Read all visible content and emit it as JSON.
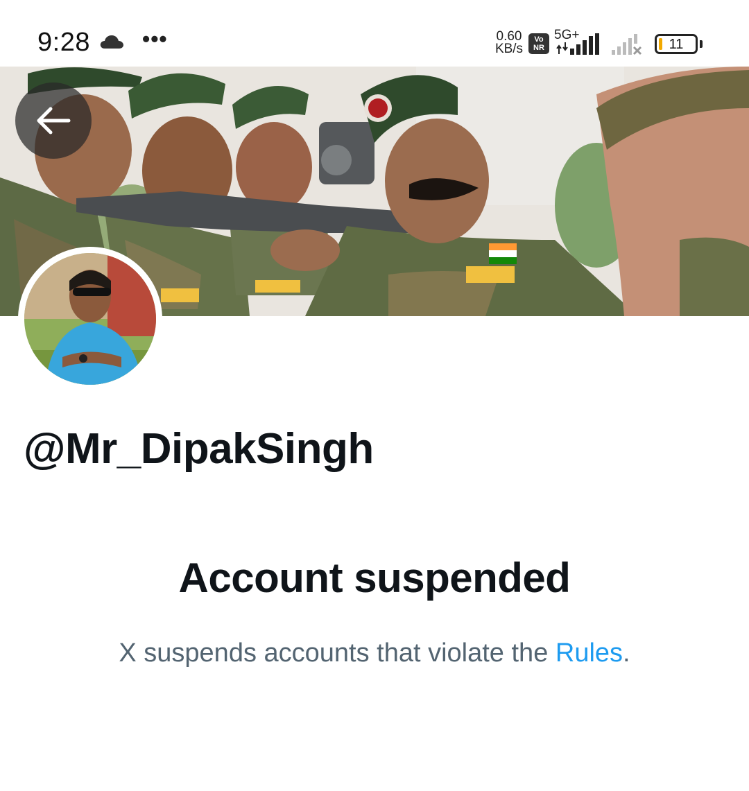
{
  "status_bar": {
    "time": "9:28",
    "weather_icon": "cloud-icon",
    "more_indicator": "•••",
    "net_speed_value": "0.60",
    "net_speed_unit": "KB/s",
    "volte_top": "Vo",
    "volte_bottom": "NR",
    "network_type": "5G+",
    "battery_level": "11",
    "battery_color": "#f2a900"
  },
  "header": {
    "back_icon": "arrow-left-icon"
  },
  "profile": {
    "handle": "@Mr_DipakSingh"
  },
  "suspension": {
    "title": "Account suspended",
    "description_prefix": "X suspends accounts that violate the ",
    "rules_link": "Rules",
    "description_suffix": ".",
    "link_color": "#1d9bf0"
  }
}
